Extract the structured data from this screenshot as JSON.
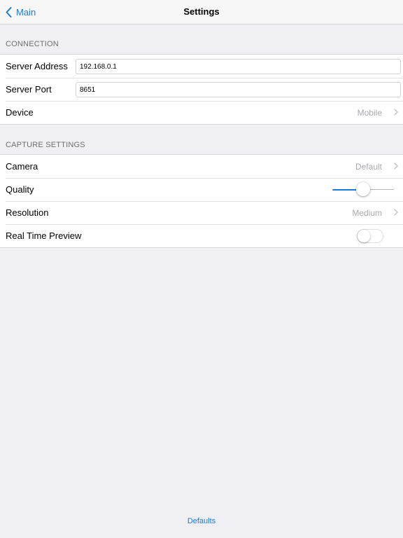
{
  "navbar": {
    "back_label": "Main",
    "title": "Settings"
  },
  "sections": {
    "connection_header": "CONNECTION",
    "capture_header": "CAPTURE SETTINGS"
  },
  "connection": {
    "server_address_label": "Server Address",
    "server_address_value": "192.168.0.1",
    "server_port_label": "Server Port",
    "server_port_value": "8651",
    "device_label": "Device",
    "device_value": "Mobile"
  },
  "capture": {
    "camera_label": "Camera",
    "camera_value": "Default",
    "quality_label": "Quality",
    "quality_level": 0.5,
    "resolution_label": "Resolution",
    "resolution_value": "Medium",
    "preview_label": "Real Time Preview",
    "preview_on": false
  },
  "footer": {
    "defaults_label": "Defaults"
  },
  "colors": {
    "accent": "#1a7bd8",
    "background": "#efeff4",
    "detail_text": "#a8a8ad"
  }
}
